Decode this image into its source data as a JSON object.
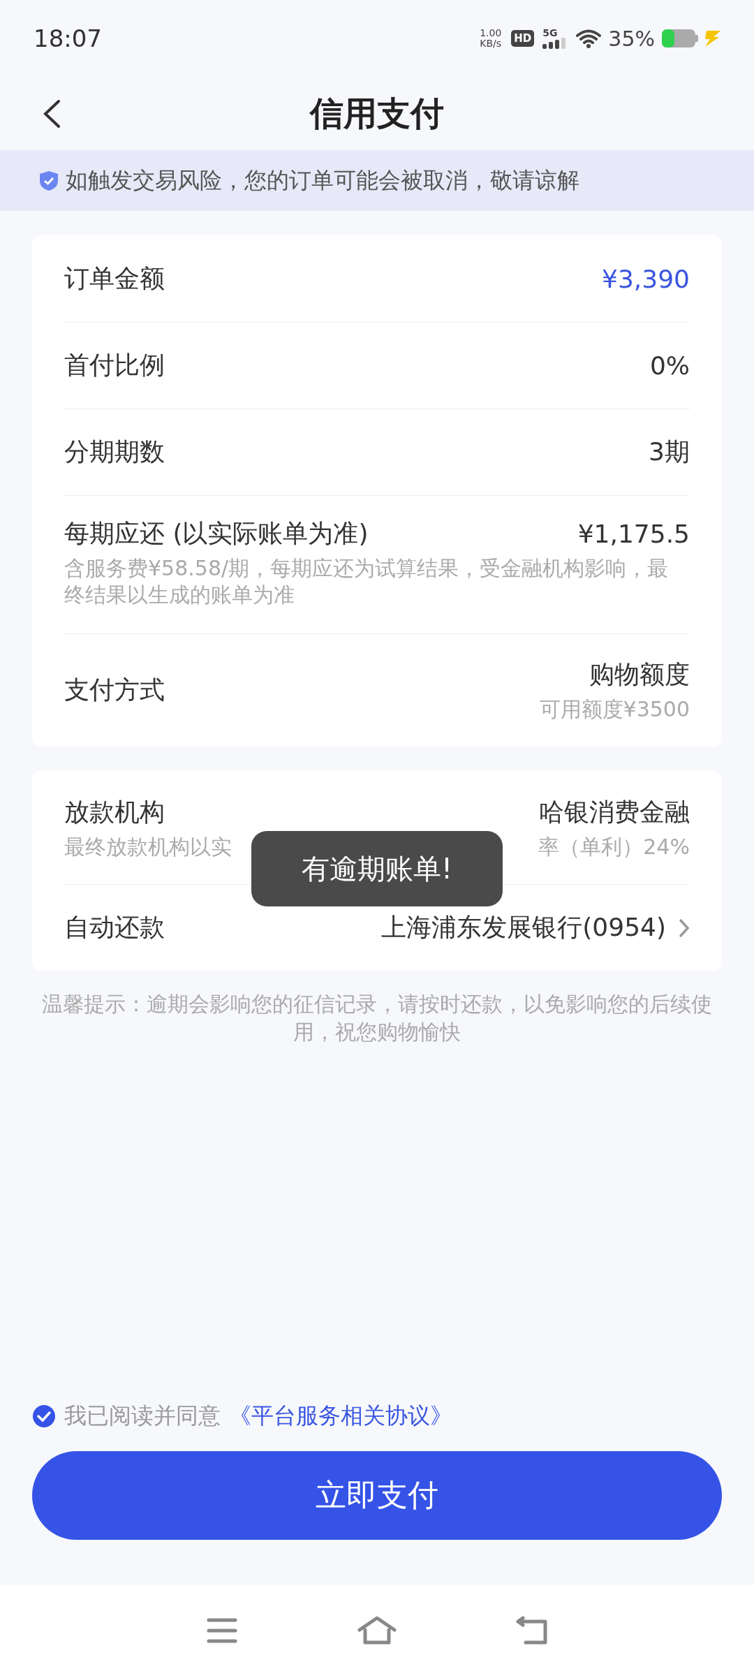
{
  "status_bar": {
    "time": "18:07",
    "net_speed": "1.00",
    "net_unit": "KB/s",
    "hd": "HD",
    "network": "5G",
    "battery": "35%",
    "charging": true
  },
  "header": {
    "title": "信用支付"
  },
  "notice": {
    "text": "如触发交易风险，您的订单可能会被取消，敬请谅解"
  },
  "cards": [
    {
      "rows": [
        {
          "kind": "pair",
          "label": "订单金额",
          "value": "¥3,390",
          "accent": true,
          "chevron": false
        },
        {
          "kind": "pair",
          "label": "首付比例",
          "value": "0%",
          "accent": false,
          "chevron": false
        },
        {
          "kind": "pair",
          "label": "分期期数",
          "value": "3期",
          "accent": false,
          "chevron": false
        },
        {
          "kind": "stacked",
          "label": "每期应还 (以实际账单为准)",
          "value": "¥1,175.5",
          "note": "含服务费¥58.58/期，每期应还为试算结果，受金融机构影响，最终结果以生成的账单为准",
          "accent": false,
          "chevron": false
        },
        {
          "kind": "pair",
          "label": "支付方式",
          "value": "购物额度",
          "value_note": "可用额度¥3500",
          "accent": false,
          "chevron": false
        }
      ]
    },
    {
      "rows": [
        {
          "kind": "pair",
          "label": "放款机构",
          "note": "最终放款机构以实",
          "value": "哈银消费金融",
          "value_note": "率（单利）24%",
          "accent": false,
          "chevron": false
        },
        {
          "kind": "pair",
          "label": "自动还款",
          "value": "上海浦东发展银行(0954)",
          "accent": false,
          "chevron": true
        }
      ]
    }
  ],
  "tip": "温馨提示：逾期会影响您的征信记录，请按时还款，以免影响您的后续使用，祝您购物愉快",
  "agreement": {
    "checked": true,
    "text": "我已阅读并同意",
    "link": "《平台服务相关协议》"
  },
  "pay_button": "立即支付",
  "toast": "有逾期账单!"
}
